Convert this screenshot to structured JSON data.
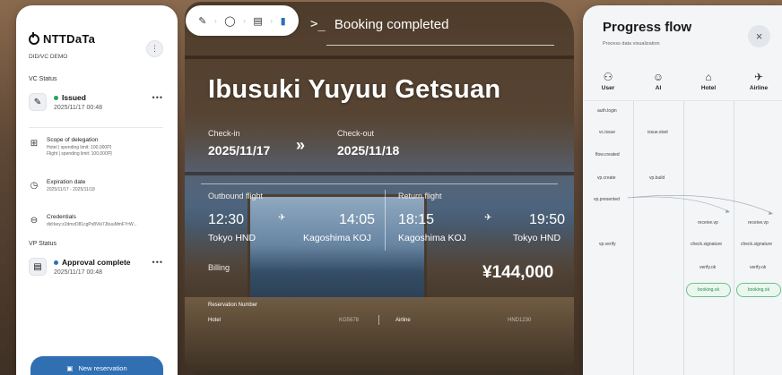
{
  "left_panel": {
    "brand": "NTTDaTa",
    "demo_label": "DID/VC DEMO",
    "menu_icon": "kebab-vertical-icon",
    "vc_status": {
      "heading": "VC Status",
      "title": "Issued",
      "date": "2025/11/17 00:48",
      "status_color": "#22a35a",
      "more": "•••"
    },
    "scope": {
      "title": "Scope of delegation",
      "line1": "Hotel | spending limit: 100,000円",
      "line2": "Flight | spending limit: 100,000円"
    },
    "expiration": {
      "title": "Expiration date",
      "range": "2025/11/17 - 2025/11/18"
    },
    "credentials": {
      "title": "Credentials",
      "value": "did:key:z2dmzD81cgPx8Vki7JbuuMmFYrW..."
    },
    "vp_status": {
      "heading": "VP Status",
      "title": "Approval complete",
      "date": "2025/11/17 00:48",
      "status_color": "#2f6fb2",
      "more": "•••"
    },
    "new_reservation": "New reservation"
  },
  "toolbar": {
    "icons": [
      "pen-icon",
      "chat-bubble-icon",
      "document-icon",
      "clipboard-icon"
    ],
    "active_color": "#2f6fb2"
  },
  "booking": {
    "header_prompt": ">_",
    "header_text": "Booking completed",
    "hotel_name": "Ibusuki Yuyuu Getsuan",
    "checkin_label": "Check-in",
    "checkin_date": "2025/11/17",
    "checkout_label": "Check-out",
    "checkout_date": "2025/11/18",
    "arrow": "»",
    "outbound": {
      "label": "Outbound flight",
      "dep_time": "12:30",
      "arr_time": "14:05",
      "from": "Tokyo HND",
      "to": "Kagoshima KOJ"
    },
    "return": {
      "label": "Return flight",
      "dep_time": "18:15",
      "arr_time": "19:50",
      "from": "Kagoshima KOJ",
      "to": "Tokyo HND"
    },
    "billing_label": "Billing",
    "price": "¥144,000",
    "reservation_label": "Reservation Number",
    "hotel_label": "Hotel",
    "hotel_code": "KG5678",
    "airline_label": "Airline",
    "airline_code": "HND1230"
  },
  "progress": {
    "title": "Progress flow",
    "subtitle": "Process data visualization",
    "close": "×",
    "actors": [
      {
        "label": "User",
        "icon": "user-icon"
      },
      {
        "label": "AI",
        "icon": "ai-face-icon"
      },
      {
        "label": "Hotel",
        "icon": "hotel-icon"
      },
      {
        "label": "Airline",
        "icon": "airplane-icon"
      }
    ],
    "steps": {
      "auth_login": "auth.login",
      "vc_issue": "vc.issue",
      "issue_start": "issue.start",
      "flow_created": "flow.created",
      "vp_create": "vp.create",
      "vp_build": "vp.build",
      "vp_presented": "vp.presented",
      "receive_vp_hotel": "receive.vp",
      "receive_vp_airline": "receive.vp",
      "vp_verify": "vp.verify",
      "check_sig_hotel": "check.signature",
      "check_sig_airline": "check.signature",
      "verify_ok_hotel": "verify.ok",
      "verify_ok_airline": "verify.ok",
      "booking_ok_hotel": "booking.ok",
      "booking_ok_airline": "booking.ok"
    },
    "accent_color": "#6cc08b"
  }
}
